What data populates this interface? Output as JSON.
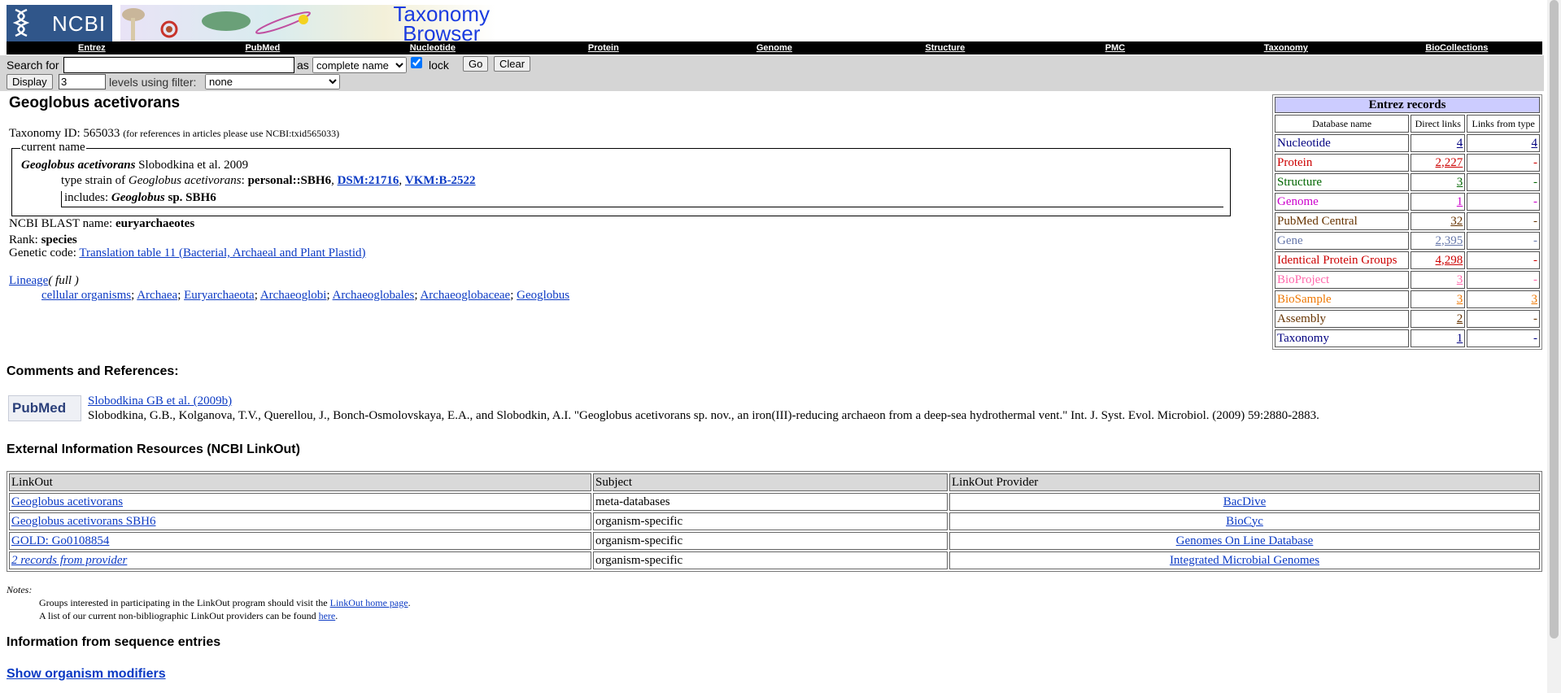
{
  "header": {
    "logo_text": "NCBI",
    "banner_title_1": "Taxonomy",
    "banner_title_2": "Browser"
  },
  "nav": [
    "Entrez",
    "PubMed",
    "Nucleotide",
    "Protein",
    "Genome",
    "Structure",
    "PMC",
    "Taxonomy",
    "BioCollections"
  ],
  "search": {
    "search_for_label": "Search for",
    "search_value": "",
    "as_label": "as",
    "as_selected": "complete name",
    "lock_label": "lock",
    "lock_checked": true,
    "go_label": "Go",
    "clear_label": "Clear",
    "display_label": "Display",
    "display_value": "3",
    "levels_label": "levels using filter:",
    "filter_selected": "none"
  },
  "taxon": {
    "title": "Geoglobus acetivorans",
    "taxonomy_id_label": "Taxonomy ID: 565033",
    "taxonomy_id_note": "(for references in articles please use NCBI:txid565033)",
    "current_name_legend": "current name",
    "current_name_species": "Geoglobus acetivorans",
    "current_name_author": "Slobodkina et al. 2009",
    "type_strain_prefix": "type strain of",
    "type_strain_species": "Geoglobus acetivorans",
    "type_strain_colon": ":",
    "type_strain_value": "personal::SBH6",
    "type_strain_links": [
      "DSM:21716",
      "VKM:B-2522"
    ],
    "includes_label": "includes:",
    "includes_genus": "Geoglobus",
    "includes_rest": "sp. SBH6",
    "blast_label": "NCBI BLAST name:",
    "blast_value": "euryarchaeotes",
    "rank_label": "Rank:",
    "rank_value": "species",
    "genetic_code_label": "Genetic code:",
    "genetic_code_link": "Translation table 11 (Bacterial, Archaeal and Plant Plastid)",
    "lineage_link": "Lineage",
    "lineage_full": "( full )",
    "lineage": [
      "cellular organisms",
      "Archaea",
      "Euryarchaeota",
      "Archaeoglobi",
      "Archaeoglobales",
      "Archaeoglobaceae",
      "Geoglobus"
    ]
  },
  "entrez": {
    "title": "Entrez records",
    "col_db": "Database name",
    "col_direct": "Direct links",
    "col_type": "Links from type",
    "rows": [
      {
        "name": "Nucleotide",
        "direct": "4",
        "type": "4",
        "color": "#000080"
      },
      {
        "name": "Protein",
        "direct": "2,227",
        "type": "-",
        "color": "#cc0000"
      },
      {
        "name": "Structure",
        "direct": "3",
        "type": "-",
        "color": "#006600"
      },
      {
        "name": "Genome",
        "direct": "1",
        "type": "-",
        "color": "#cc00cc"
      },
      {
        "name": "PubMed Central",
        "direct": "32",
        "type": "-",
        "color": "#663300"
      },
      {
        "name": "Gene",
        "direct": "2,395",
        "type": "-",
        "color": "#6677aa"
      },
      {
        "name": "Identical Protein Groups",
        "direct": "4,298",
        "type": "-",
        "color": "#cc0000"
      },
      {
        "name": "BioProject",
        "direct": "3",
        "type": "-",
        "color": "#ff66aa"
      },
      {
        "name": "BioSample",
        "direct": "3",
        "type": "3",
        "color": "#ee7700"
      },
      {
        "name": "Assembly",
        "direct": "2",
        "type": "-",
        "color": "#663300"
      },
      {
        "name": "Taxonomy",
        "direct": "1",
        "type": "-",
        "color": "#000080"
      }
    ]
  },
  "comments": {
    "heading": "Comments and References:",
    "pubmed_logo": "PubMed",
    "ref_link": "Slobodkina GB et al. (2009b)",
    "ref_text": "Slobodkina, G.B., Kolganova, T.V., Querellou, J., Bonch-Osmolovskaya, E.A., and Slobodkin, A.I. \"Geoglobus acetivorans sp. nov., an iron(III)-reducing archaeon from a deep-sea hydrothermal vent.\" Int. J. Syst. Evol. Microbiol. (2009) 59:2880-2883."
  },
  "linkout": {
    "heading": "External Information Resources (NCBI LinkOut)",
    "headers": [
      "LinkOut",
      "Subject",
      "LinkOut Provider"
    ],
    "rows": [
      {
        "link": "Geoglobus acetivorans",
        "subject": "meta-databases",
        "provider": "BacDive"
      },
      {
        "link": "Geoglobus acetivorans SBH6",
        "subject": "organism-specific",
        "provider": "BioCyc"
      },
      {
        "link": "GOLD: Go0108854",
        "subject": "organism-specific",
        "provider": "Genomes On Line Database"
      },
      {
        "link": "2 records from provider",
        "subject": "organism-specific",
        "provider": "Integrated Microbial Genomes"
      }
    ]
  },
  "notes": {
    "label": "Notes:",
    "line1_text": "Groups interested in participating in the LinkOut program should visit the",
    "line1_link": "LinkOut home page",
    "line1_end": ".",
    "line2_text": "A list of our current non-bibliographic LinkOut providers can be found",
    "line2_link": "here",
    "line2_end": "."
  },
  "seq": {
    "heading": "Information from sequence entries",
    "show_modifiers": "Show organism modifiers"
  }
}
